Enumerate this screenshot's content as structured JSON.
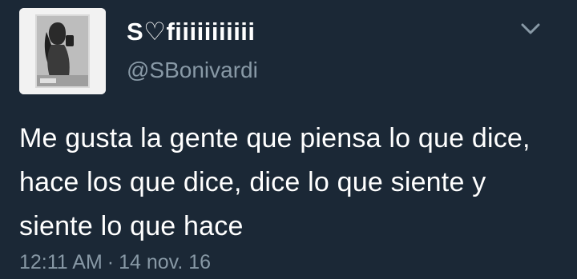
{
  "tweet": {
    "display_name": "S♡fiiiiiiiiiii",
    "handle": "@SBonivardi",
    "text": "Me gusta la gente que piensa lo que dice, hace los que dice, dice lo que siente y siente lo que hace",
    "time": "12:11 AM",
    "separator": "·",
    "date": "14 nov. 16"
  },
  "icons": {
    "menu": "chevron-down-icon",
    "avatar": "profile-photo"
  },
  "colors": {
    "background": "#1b2836",
    "primary_text": "#ffffff",
    "secondary_text": "#8899a6"
  }
}
